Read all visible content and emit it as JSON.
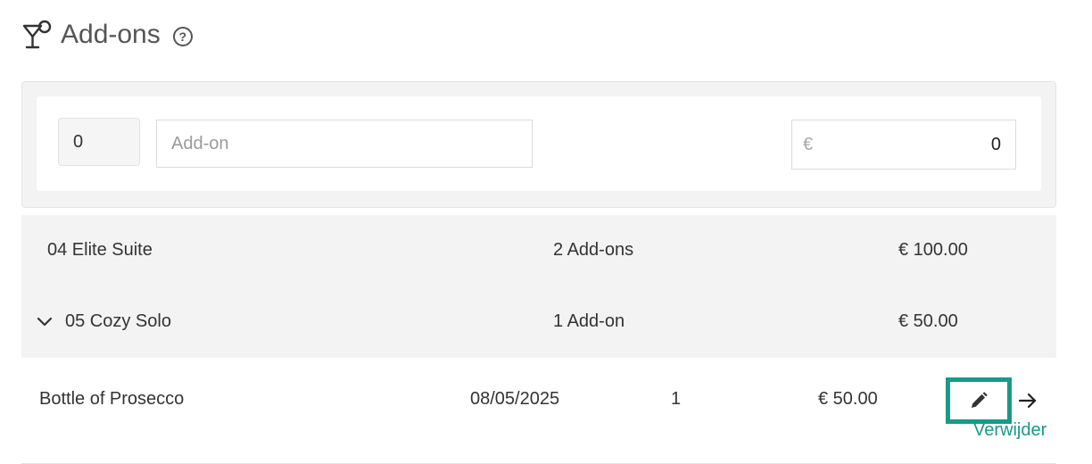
{
  "header": {
    "title": "Add-ons",
    "help": "?"
  },
  "form": {
    "quantity_value": "0",
    "addon_placeholder": "Add-on",
    "currency_symbol": "€",
    "price_value": "0"
  },
  "groups": [
    {
      "name": "04 Elite Suite",
      "count": "2 Add-ons",
      "total": "€ 100.00",
      "expanded": false
    },
    {
      "name": "05 Cozy Solo",
      "count": "1 Add-on",
      "total": "€ 50.00",
      "expanded": true
    }
  ],
  "items": [
    {
      "name": "Bottle of Prosecco",
      "date": "08/05/2025",
      "qty": "1",
      "price": "€ 50.00",
      "remove_label": "Verwijder"
    }
  ],
  "colors": {
    "accent": "#1a9a86",
    "panel_bg": "#f3f3f3"
  }
}
